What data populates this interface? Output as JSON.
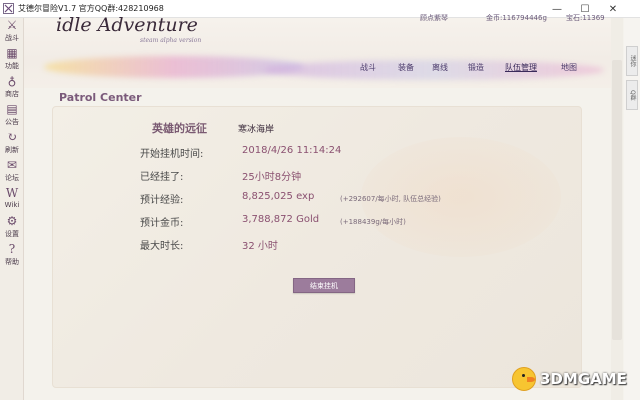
{
  "window": {
    "title": "艾德尔冒险V1.7 官方QQ群:428210968",
    "minimize_glyph": "—",
    "maximize_glyph": "☐",
    "close_glyph": "✕"
  },
  "sidebar": {
    "items": [
      {
        "label": "战斗",
        "icon": "crossed-swords-icon",
        "glyph": "⚔"
      },
      {
        "label": "功能",
        "icon": "grid-icon",
        "glyph": "▦"
      },
      {
        "label": "商店",
        "icon": "shop-icon",
        "glyph": "♁"
      },
      {
        "label": "公告",
        "icon": "notice-icon",
        "glyph": "▤"
      },
      {
        "label": "刷新",
        "icon": "refresh-icon",
        "glyph": "↻"
      },
      {
        "label": "论坛",
        "icon": "forum-icon",
        "glyph": "✉"
      },
      {
        "label": "Wiki",
        "icon": "wiki-icon",
        "glyph": "W"
      },
      {
        "label": "设置",
        "icon": "gear-icon",
        "glyph": "⚙"
      },
      {
        "label": "帮助",
        "icon": "help-icon",
        "glyph": "?"
      }
    ]
  },
  "right_strip": {
    "tabs": [
      "迷你",
      "Q群"
    ]
  },
  "header": {
    "logo": "idle Adventure",
    "logo_sub": "steam alpha version",
    "player_name": "顾点紫琴",
    "gold_label": "金币:116794446g",
    "gem_label": "宝石:11369",
    "nav": [
      {
        "label": "战斗",
        "active": false
      },
      {
        "label": "装备",
        "active": false
      },
      {
        "label": "离线",
        "active": false
      },
      {
        "label": "锻造",
        "active": false
      },
      {
        "label": "队伍管理",
        "active": true
      },
      {
        "label": "地图",
        "active": false
      }
    ]
  },
  "patrol": {
    "section_title": "Patrol Center",
    "heading": "英雄的远征",
    "location": "寒冰海岸",
    "rows": [
      {
        "label": "开始挂机时间:",
        "value": "2018/4/26 11:14:24",
        "note": ""
      },
      {
        "label": "已经挂了:",
        "value": "25小时8分钟",
        "note": ""
      },
      {
        "label": "预计经验:",
        "value": "8,825,025 exp",
        "note": "(+292607/每小时, 队伍总经验)"
      },
      {
        "label": "预计金币:",
        "value": "3,788,872 Gold",
        "note": "(+188439g/每小时)"
      },
      {
        "label": "最大时长:",
        "value": "32 小时",
        "note": ""
      }
    ],
    "end_button": "结束挂机"
  },
  "watermark": {
    "text": "3DMGAME"
  }
}
